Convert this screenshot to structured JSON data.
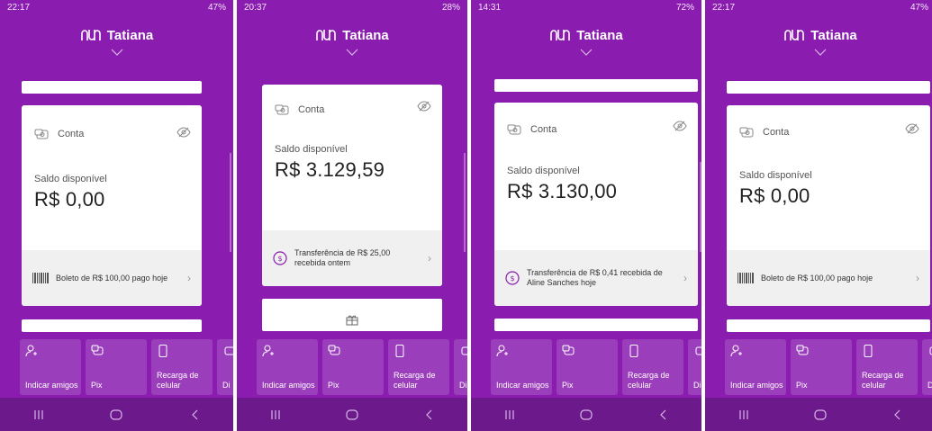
{
  "screens": [
    {
      "status_time": "22:17",
      "status_right": "47%",
      "user_name": "Tatiana",
      "account_label": "Conta",
      "balance_label": "Saldo disponível",
      "balance_value": "R$ 0,00",
      "footer_text": "Boleto de R$ 100,00 pago hoje",
      "footer_icon": "barcode-icon"
    },
    {
      "status_time": "20:37",
      "status_right": "28%",
      "user_name": "Tatiana",
      "account_label": "Conta",
      "balance_label": "Saldo disponível",
      "balance_value": "R$ 3.129,59",
      "footer_text": "Transferência de R$ 25,00 recebida ontem",
      "footer_icon": "money-circle-icon"
    },
    {
      "status_time": "14:31",
      "status_right": "72%",
      "user_name": "Tatiana",
      "account_label": "Conta",
      "balance_label": "Saldo disponível",
      "balance_value": "R$ 3.130,00",
      "footer_text": "Transferência de R$ 0,41 recebida de Aline Sanches hoje",
      "footer_icon": "money-circle-icon"
    },
    {
      "status_time": "22:17",
      "status_right": "47%",
      "user_name": "Tatiana",
      "account_label": "Conta",
      "balance_label": "Saldo disponível",
      "balance_value": "R$ 0,00",
      "footer_text": "Boleto de R$ 100,00 pago hoje",
      "footer_icon": "barcode-icon"
    }
  ],
  "shortcuts": [
    {
      "label": "Indicar amigos",
      "icon": "add-person-icon"
    },
    {
      "label": "Pix",
      "icon": "pix-money-icon"
    },
    {
      "label": "Recarga de celular",
      "icon": "phone-icon"
    },
    {
      "label": "Di",
      "icon": "money-icon"
    }
  ],
  "colors": {
    "brand_purple": "#8a1db0",
    "nav_purple": "#6b198b",
    "card_white": "#ffffff",
    "footer_gray": "#f0f0f0"
  }
}
